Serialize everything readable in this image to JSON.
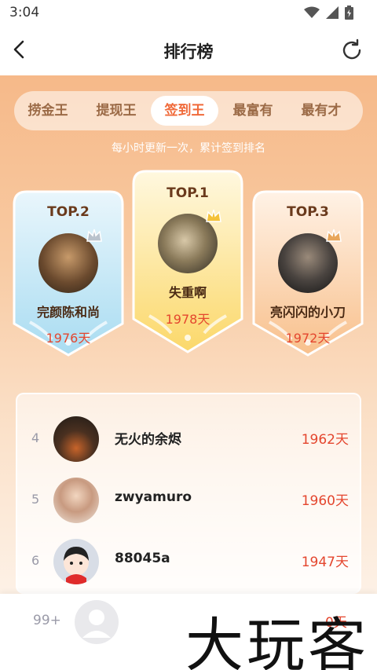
{
  "status": {
    "time": "3:04"
  },
  "nav": {
    "title": "排行榜"
  },
  "tabs": [
    {
      "label": "捞金王",
      "active": false
    },
    {
      "label": "提现王",
      "active": false
    },
    {
      "label": "签到王",
      "active": true
    },
    {
      "label": "最富有",
      "active": false
    },
    {
      "label": "最有才",
      "active": false
    }
  ],
  "subtitle": "每小时更新一次，累计签到排名",
  "top3": [
    {
      "rank": "TOP.1",
      "name": "失重啊",
      "days": "1978天"
    },
    {
      "rank": "TOP.2",
      "name": "完颜陈和尚",
      "days": "1976天"
    },
    {
      "rank": "TOP.3",
      "name": "亮闪闪的小刀",
      "days": "1972天"
    }
  ],
  "list": [
    {
      "index": "4",
      "name": "无火的余烬",
      "days": "1962天"
    },
    {
      "index": "5",
      "name": "zwyamuro",
      "days": "1960天"
    },
    {
      "index": "6",
      "name": "88045a",
      "days": "1947天"
    }
  ],
  "me": {
    "rank": "99+",
    "days": "0天"
  },
  "watermark": "大玩客",
  "colors": {
    "accent": "#f06a3a",
    "days": "#e4462e",
    "bg_top": "#f6b989"
  }
}
